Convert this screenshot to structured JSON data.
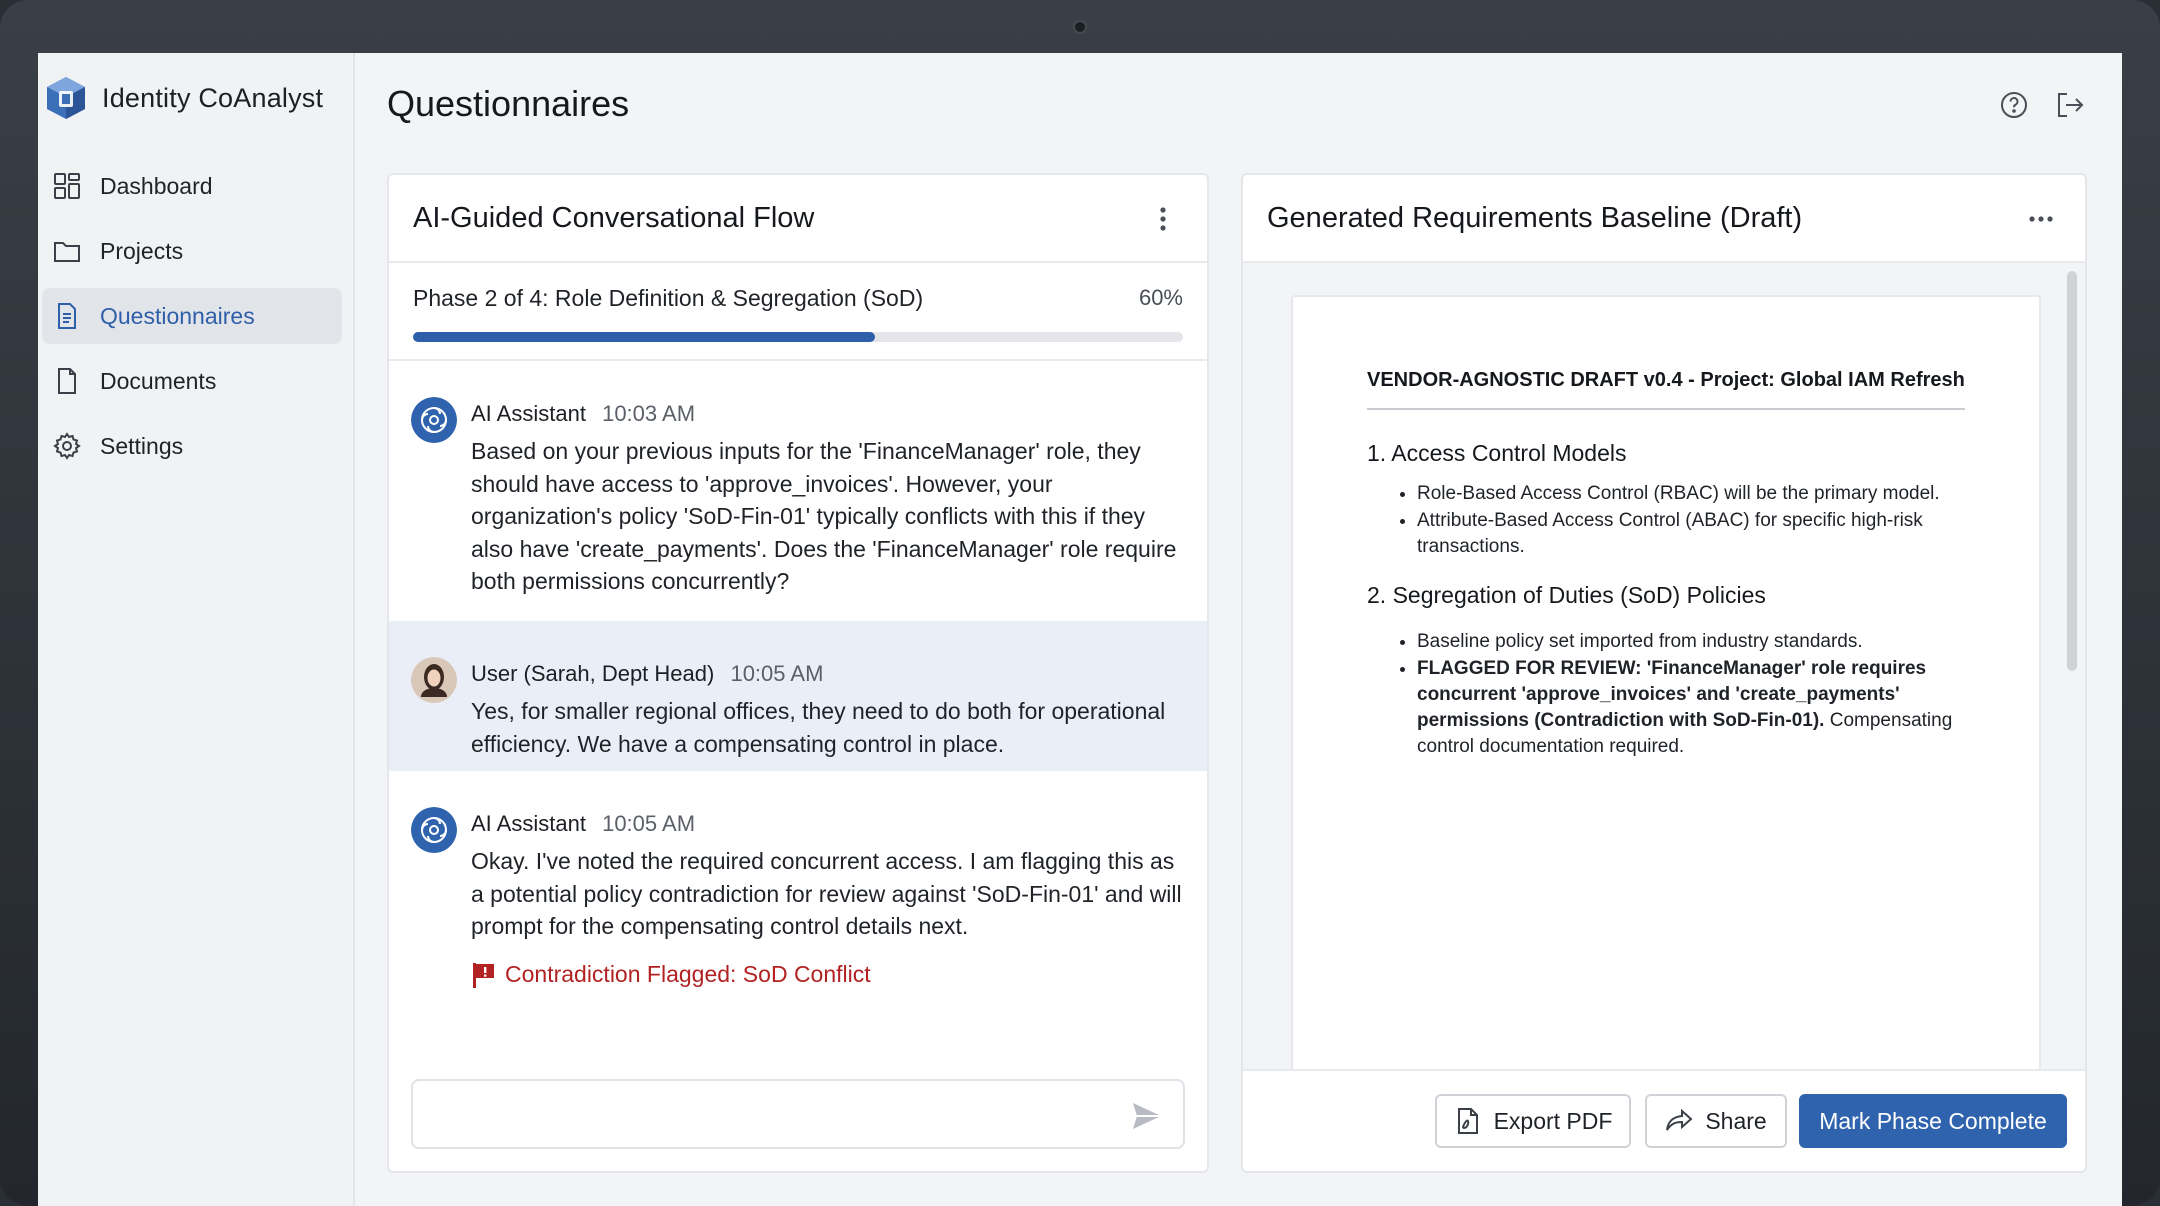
{
  "app": {
    "name": "Identity CoAnalyst"
  },
  "sidebar": {
    "items": [
      {
        "label": "Dashboard",
        "icon": "dashboard-icon",
        "active": false
      },
      {
        "label": "Projects",
        "icon": "folder-icon",
        "active": false
      },
      {
        "label": "Questionnaires",
        "icon": "document-list-icon",
        "active": true
      },
      {
        "label": "Documents",
        "icon": "file-icon",
        "active": false
      },
      {
        "label": "Settings",
        "icon": "gear-icon",
        "active": false
      }
    ]
  },
  "header": {
    "title": "Questionnaires",
    "icons": [
      "help-icon",
      "logout-icon"
    ]
  },
  "chat": {
    "title": "AI-Guided Conversational Flow",
    "progress": {
      "label": "Phase 2 of 4: Role Definition & Segregation (SoD)",
      "percent_label": "60%",
      "value": 0.6
    },
    "messages": [
      {
        "author": "AI Assistant",
        "time": "10:03 AM",
        "text": "Based on your previous inputs for the 'FinanceManager' role, they should have access to 'approve_invoices'. However, your organization's policy 'SoD-Fin-01' typically conflicts with this if they also have 'create_payments'. Does the 'FinanceManager' role require both permissions concurrently?"
      },
      {
        "author": "User (Sarah, Dept Head)",
        "time": "10:05 AM",
        "text": "Yes, for smaller regional offices, they need to do both for operational efficiency. We have a compensating control in place."
      },
      {
        "author": "AI Assistant",
        "time": "10:05 AM",
        "text": "Okay. I've noted the required concurrent access. I am flagging this as a potential policy contradiction for review against 'SoD-Fin-01' and will prompt for the compensating control details next.",
        "flag": "Contradiction Flagged: SoD Conflict"
      }
    ],
    "input": {
      "placeholder": ""
    }
  },
  "requirements": {
    "title": "Generated Requirements Baseline (Draft)",
    "doc": {
      "title": "VENDOR-AGNOSTIC DRAFT v0.4 - Project: Global IAM Refresh",
      "sections": [
        {
          "heading": "1. Access Control Models",
          "items": [
            "Role-Based Access Control (RBAC) will be the primary model.",
            "Attribute-Based Access Control (ABAC) for specific high-risk transactions."
          ]
        },
        {
          "heading": "2. Segregation of Duties (SoD) Policies",
          "items": [
            "Baseline policy set imported from industry standards."
          ],
          "flagged": {
            "bold": "FLAGGED FOR REVIEW: 'FinanceManager' role requires concurrent 'approve_invoices' and 'create_payments' permissions (Contradiction with SoD-Fin-01).",
            "normal": "Compensating control documentation required."
          }
        }
      ]
    },
    "buttons": {
      "export": "Export PDF",
      "share": "Share",
      "complete": "Mark Phase Complete"
    }
  },
  "colors": {
    "accent": "#2f63ad",
    "flag": "#b22222",
    "user_bubble": "#eaeff7"
  }
}
